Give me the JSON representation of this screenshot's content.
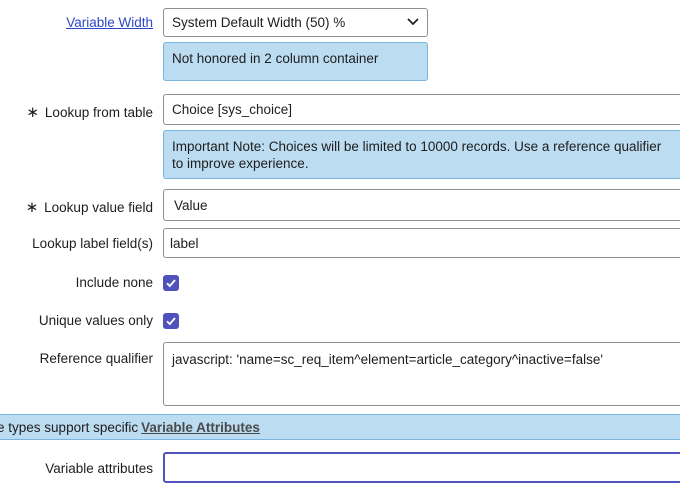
{
  "variable_width": {
    "label": "Variable Width",
    "selected": "System Default Width (50) %",
    "note": "Not honored in 2 column container"
  },
  "lookup_table": {
    "required_marker": "∗",
    "label": "Lookup from table",
    "value": "Choice [sys_choice]",
    "note": "Important Note: Choices will be limited to 10000 records. Use a reference qualifier to improve experience."
  },
  "lookup_value_field": {
    "required_marker": "∗",
    "label": "Lookup value field",
    "value": "Value"
  },
  "lookup_label_fields": {
    "label": "Lookup label field(s)",
    "value": "label"
  },
  "include_none": {
    "label": "Include none",
    "checked": true
  },
  "unique_values_only": {
    "label": "Unique values only",
    "checked": true
  },
  "reference_qualifier": {
    "label": "Reference qualifier",
    "value": "javascript: 'name=sc_req_item^element=article_category^inactive=false'"
  },
  "banner": {
    "text": "Variable types support specific",
    "link": "Variable Attributes"
  },
  "variable_attributes": {
    "label": "Variable attributes",
    "value": ""
  },
  "colors": {
    "accent": "#4f52bd",
    "note_bg": "#bcdcf2",
    "link": "#2d47c6"
  }
}
